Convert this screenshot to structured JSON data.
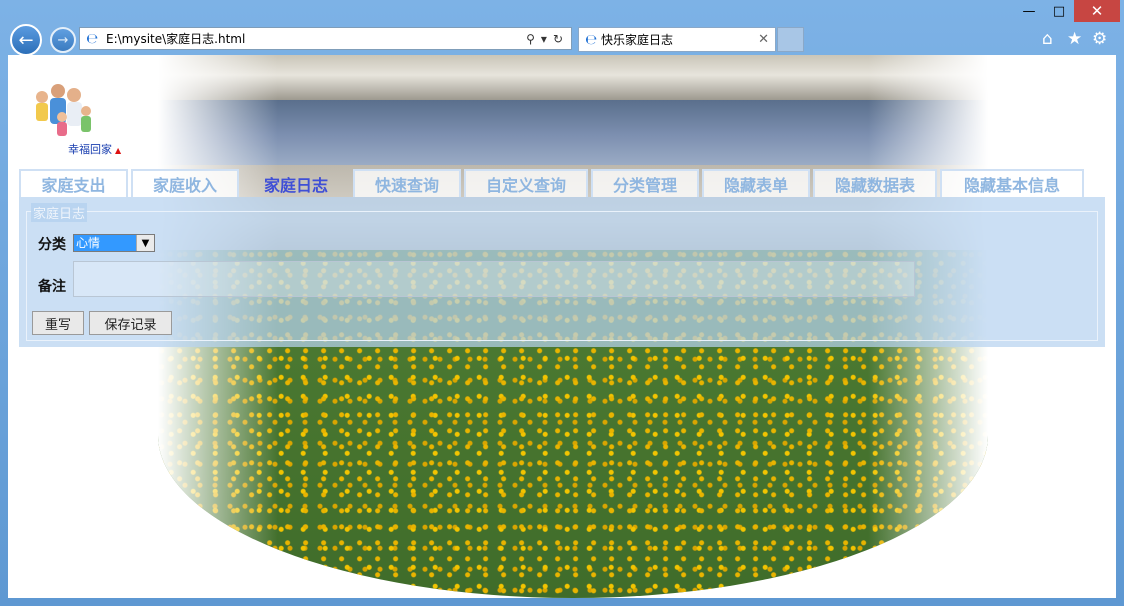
{
  "browser": {
    "address_url": "E:\\mysite\\家庭日志.html",
    "tab_title": "快乐家庭日志"
  },
  "logo": {
    "caption": "幸福回家"
  },
  "menu": [
    {
      "label": "家庭支出",
      "active": false
    },
    {
      "label": "家庭收入",
      "active": false
    },
    {
      "label": "家庭日志",
      "active": true
    },
    {
      "label": "快速查询",
      "active": false
    },
    {
      "label": "自定义查询",
      "active": false
    },
    {
      "label": "分类管理",
      "active": false
    },
    {
      "label": "隐藏表单",
      "active": false
    },
    {
      "label": "隐藏数据表",
      "active": false
    },
    {
      "label": "隐藏基本信息",
      "active": false
    }
  ],
  "form": {
    "legend": "家庭日志",
    "category_label": "分类",
    "category_value": "心情",
    "note_label": "备注",
    "note_value": "",
    "reset_label": "重写",
    "save_label": "保存记录"
  }
}
